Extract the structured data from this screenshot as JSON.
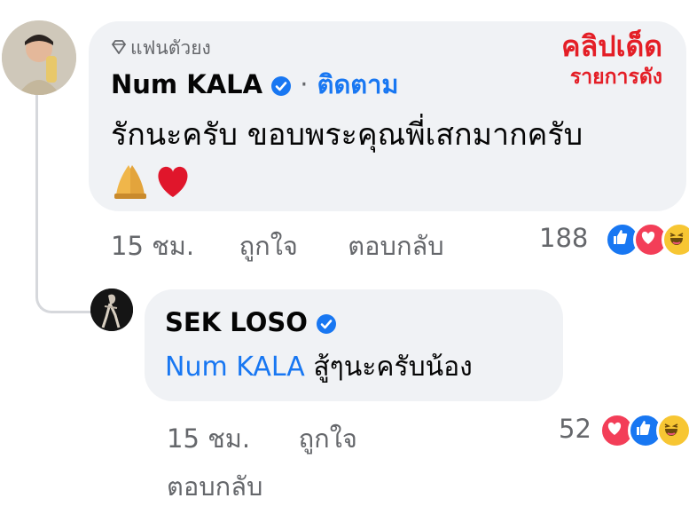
{
  "watermark": {
    "line1": "คลิปเด็ด",
    "line2": "รายการดัง"
  },
  "comment": {
    "badge_label": "แฟนตัวยง",
    "author": "Num KALA",
    "dot": "·",
    "follow": "ติดตาม",
    "text": "รักนะครับ ขอบพระคุณพี่เสกมากครับ",
    "emoji": "🙏❤️",
    "time": "15 ชม.",
    "like": "ถูกใจ",
    "reply": "ตอบกลับ",
    "reaction_count": "188",
    "reactions": [
      "like-icon",
      "love-icon",
      "haha-icon"
    ]
  },
  "reply": {
    "author": "SEK LOSO",
    "mention": "Num KALA",
    "text": " สู้ๆนะครับน้อง",
    "time": "15 ชม.",
    "like": "ถูกใจ",
    "reply": "ตอบกลับ",
    "reaction_count": "52",
    "reactions": [
      "love-icon",
      "like-icon",
      "haha-icon"
    ]
  },
  "colors": {
    "accent": "#1877f2",
    "watermark": "#e41e26",
    "bubble": "#f0f2f5",
    "meta": "#65676b"
  }
}
